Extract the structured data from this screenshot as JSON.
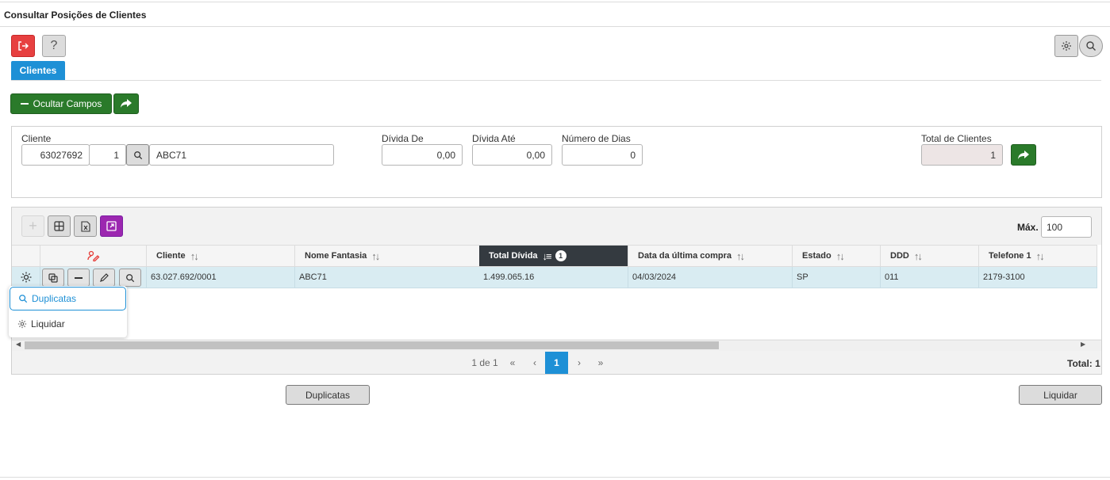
{
  "page": {
    "title": "Consultar Posições de Clientes"
  },
  "toolbar": {
    "help_label": "?"
  },
  "tabs": [
    {
      "label": "Clientes"
    }
  ],
  "actions": {
    "ocultar_campos_label": "Ocultar Campos"
  },
  "filters": {
    "cliente_label": "Cliente",
    "cliente_codigo": "63027692",
    "cliente_seq": "1",
    "cliente_nome": "ABC71",
    "divida_de_label": "Dívida De",
    "divida_de_value": "0,00",
    "divida_ate_label": "Dívida Até",
    "divida_ate_value": "0,00",
    "numero_dias_label": "Número de Dias",
    "numero_dias_value": "0",
    "total_clientes_label": "Total de Clientes",
    "total_clientes_value": "1"
  },
  "grid": {
    "max_label": "Máx.",
    "max_value": "100",
    "columns": [
      {
        "label": "Cliente"
      },
      {
        "label": "Nome Fantasia"
      },
      {
        "label": "Total Dívida",
        "sorted": true,
        "sort_order": "1"
      },
      {
        "label": "Data da última compra"
      },
      {
        "label": "Estado"
      },
      {
        "label": "DDD"
      },
      {
        "label": "Telefone 1"
      }
    ],
    "rows": [
      {
        "cliente": "63.027.692/0001",
        "nome_fantasia": "ABC71",
        "total_divida": "1.499.065.16",
        "data_ultima_compra": "04/03/2024",
        "estado": "SP",
        "ddd": "011",
        "telefone1": "2179-3100"
      }
    ],
    "row_menu": [
      {
        "label": "Duplicatas",
        "icon": "search-icon"
      },
      {
        "label": "Liquidar",
        "icon": "gear-icon"
      }
    ],
    "pager": {
      "info": "1 de 1",
      "current_page": "1",
      "total_label": "Total: 1"
    }
  },
  "bottom_buttons": {
    "duplicatas": "Duplicatas",
    "liquidar": "Liquidar"
  },
  "colors": {
    "accent": "#1e90d6",
    "green": "#2a7a2a",
    "danger": "#e74040",
    "purple": "#9c27b0",
    "row_selected": "#d9ecf2",
    "header_active": "#343a40"
  }
}
